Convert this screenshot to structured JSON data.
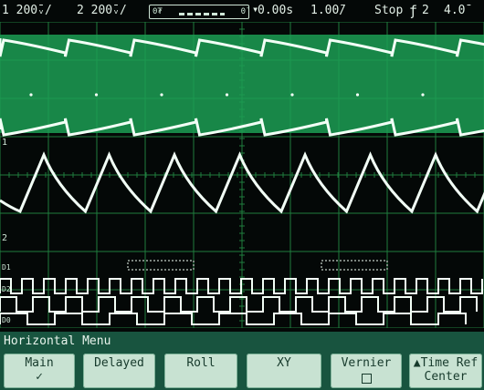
{
  "status_bar": {
    "ch1": "1 200̄ᵥ/",
    "ch2": "2 200̄ᵥ/",
    "acq_left": "0₮",
    "acq_right": "0̄",
    "trig_pos_icon": "trigger-position-marker",
    "time_offset": "0.00s",
    "time_div": "1.00̄/",
    "run_state": "Stop",
    "trig_slope_icon": "rising-edge",
    "trig_source": "2",
    "trig_level": "4.0̄"
  },
  "markers": {
    "ch1_ground": "1",
    "ch2_ground": "2",
    "d1": "D1",
    "d2": "D2",
    "d0": "D0"
  },
  "menu": {
    "title": "Horizontal Menu",
    "keys": [
      {
        "label": "Main",
        "sub": "✓"
      },
      {
        "label": "Delayed",
        "sub": ""
      },
      {
        "label": "Roll",
        "sub": ""
      },
      {
        "label": "XY",
        "sub": ""
      },
      {
        "label": "Vernier",
        "sub": ""
      },
      {
        "label": "▲Time Ref",
        "sub": "Center"
      }
    ]
  },
  "colors": {
    "trace": "#f2fff6",
    "grid": "#1f7d3e",
    "envelope": "#1c9e54",
    "menu_bg": "#18543f"
  }
}
